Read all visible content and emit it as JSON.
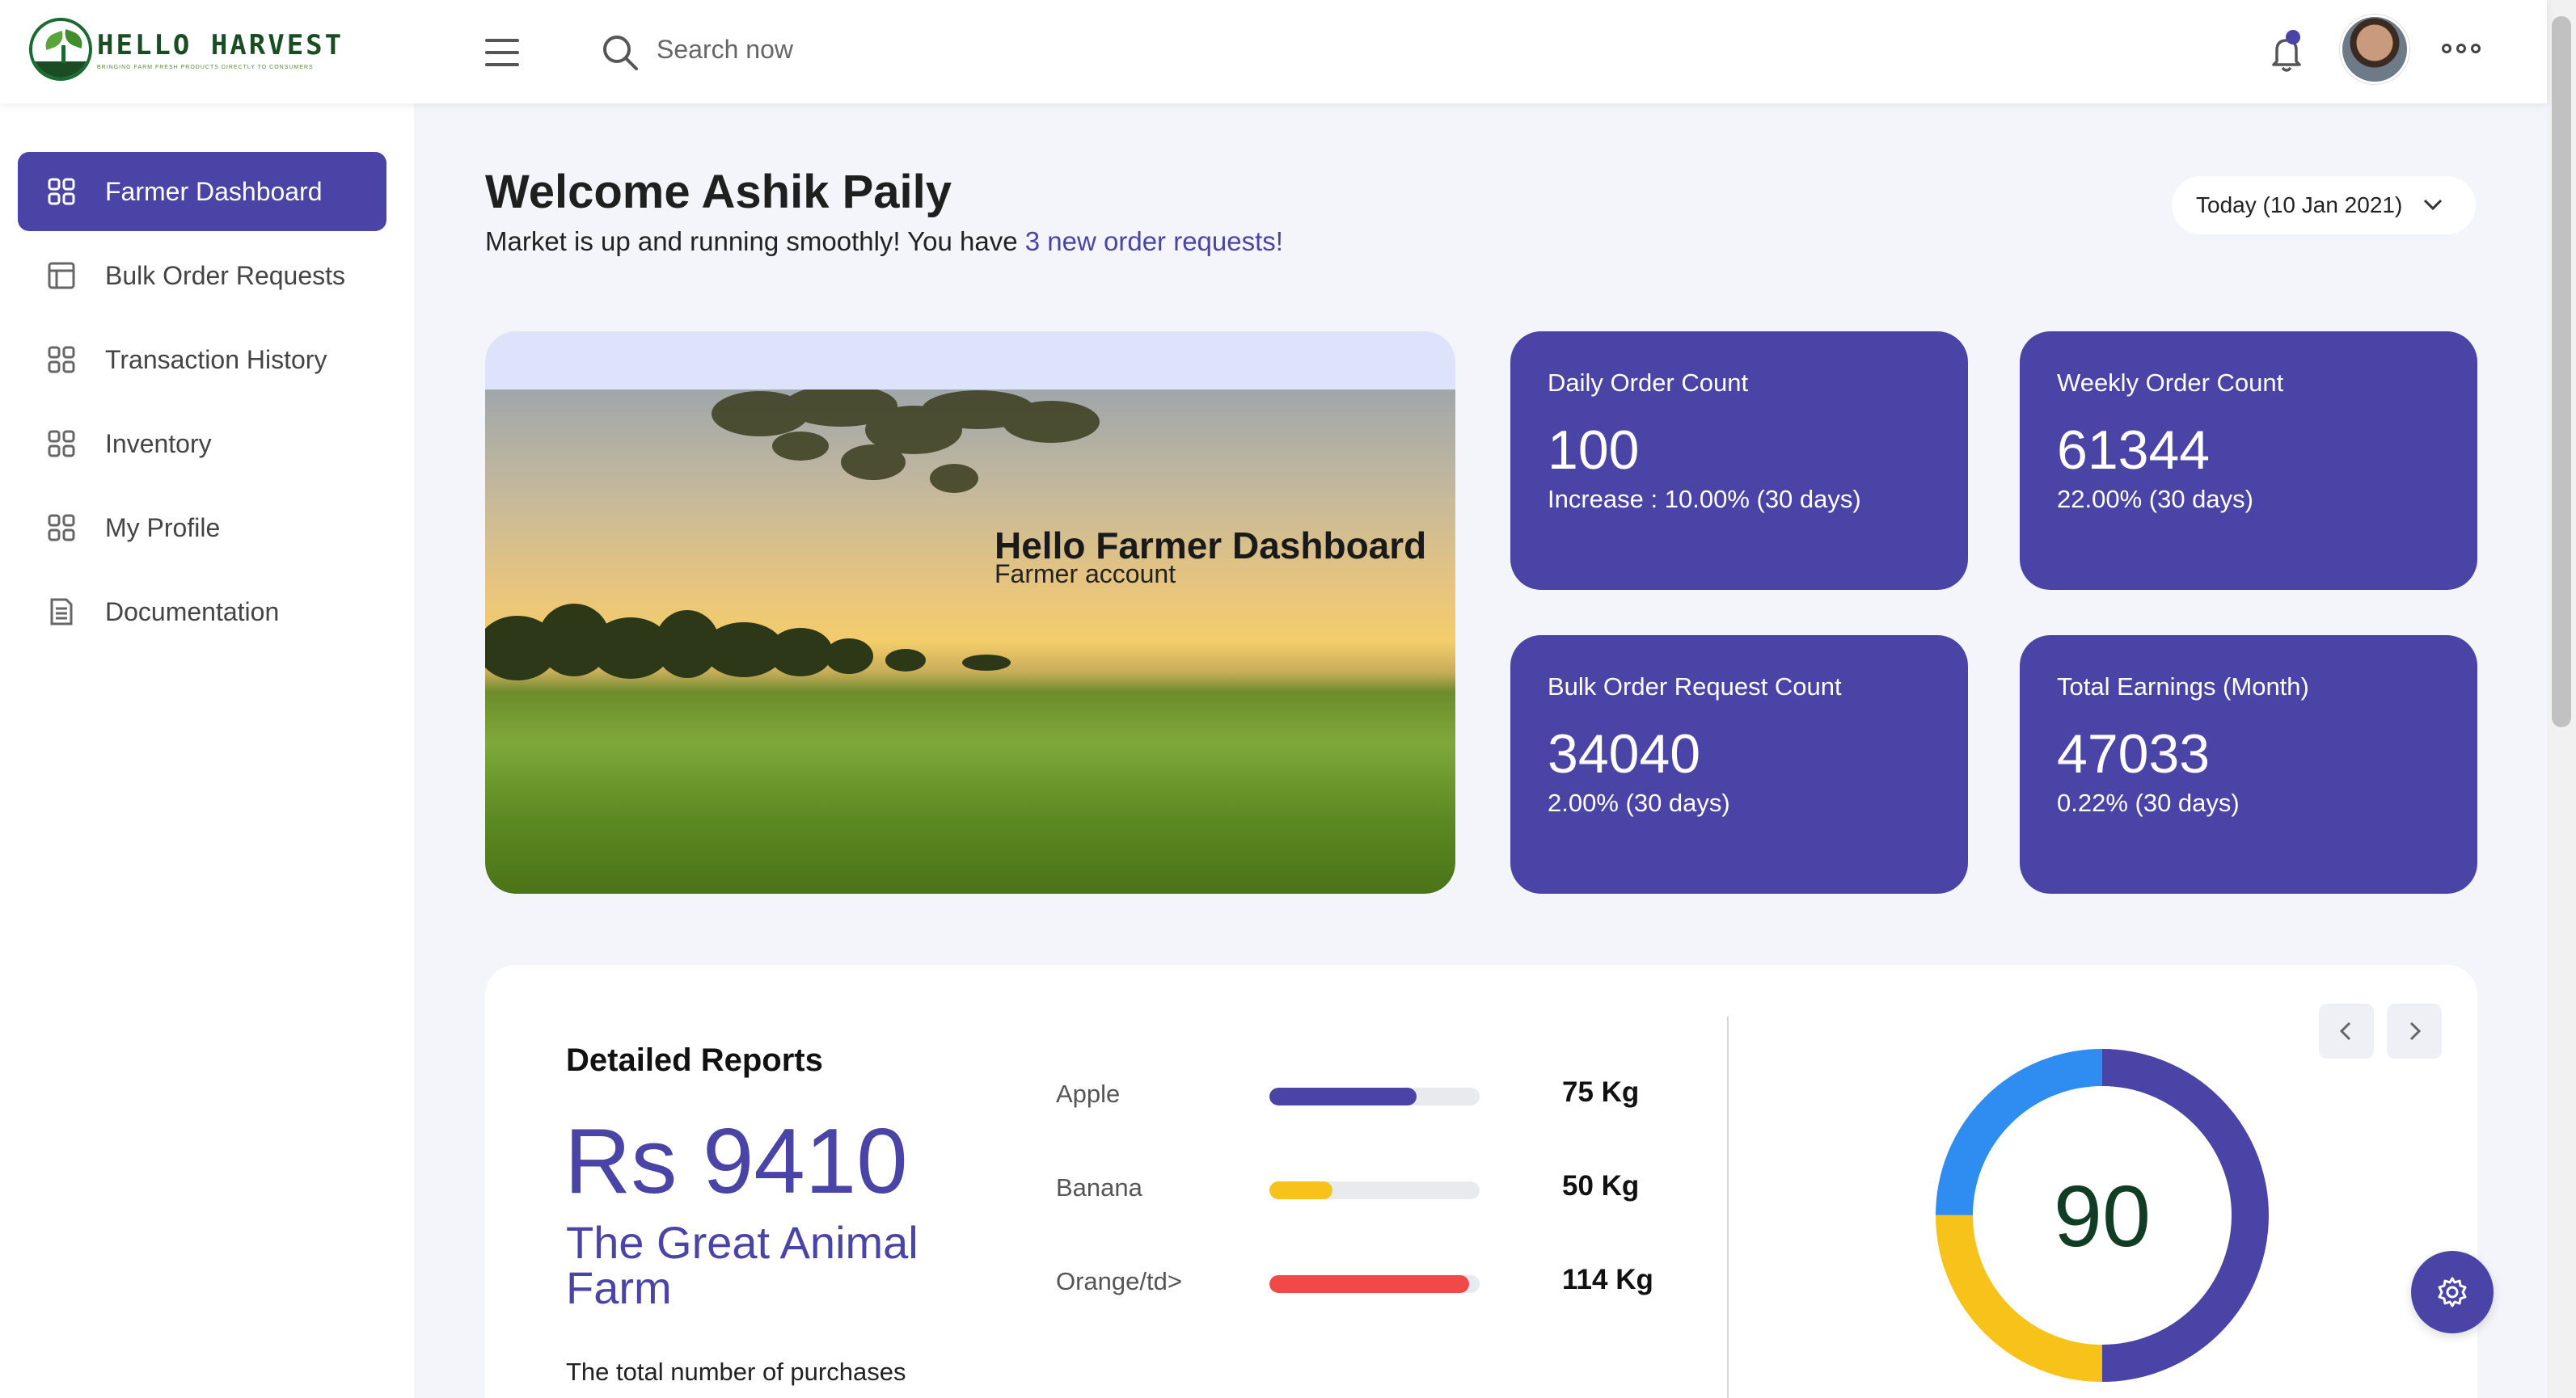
{
  "brand": {
    "name": "HELLO HARVEST",
    "tagline": "BRINGING FARM FRESH PRODUCTS DIRECTLY TO CONSUMERS"
  },
  "header": {
    "search_placeholder": "Search now",
    "notification_indicator": true
  },
  "sidebar": {
    "items": [
      {
        "label": "Farmer Dashboard",
        "icon": "grid-icon",
        "active": true
      },
      {
        "label": "Bulk Order Requests",
        "icon": "layout-icon",
        "active": false
      },
      {
        "label": "Transaction History",
        "icon": "grid-icon",
        "active": false
      },
      {
        "label": "Inventory",
        "icon": "grid-icon",
        "active": false
      },
      {
        "label": "My Profile",
        "icon": "grid-icon",
        "active": false
      },
      {
        "label": "Documentation",
        "icon": "document-icon",
        "active": false
      }
    ]
  },
  "main": {
    "welcome": "Welcome Ashik Paily",
    "subtitle_prefix": "Market is up and running smoothly! You have ",
    "subtitle_link": "3 new order requests!",
    "date_filter": "Today (10 Jan 2021)"
  },
  "hero": {
    "title": "Hello Farmer Dashboard",
    "subtitle": "Farmer account"
  },
  "stats": [
    {
      "title": "Daily Order Count",
      "value": "100",
      "change": "Increase : 10.00% (30 days)"
    },
    {
      "title": "Weekly Order Count",
      "value": "61344",
      "change": "22.00% (30 days)"
    },
    {
      "title": "Bulk Order Request Count",
      "value": "34040",
      "change": "2.00% (30 days)"
    },
    {
      "title": "Total Earnings (Month)",
      "value": "47033",
      "change": "0.22% (30 days)"
    }
  ],
  "report": {
    "title": "Detailed Reports",
    "amount": "Rs 9410",
    "farm": "The Great Animal Farm",
    "description": "The total number of purchases",
    "items": [
      {
        "name": "Apple",
        "quantity": "75 Kg",
        "progress": 0.7,
        "color": "#4a44a6"
      },
      {
        "name": "Banana",
        "quantity": "50 Kg",
        "progress": 0.3,
        "color": "#f7c21a"
      },
      {
        "name": "Orange/td>",
        "quantity": "114 Kg",
        "progress": 0.95,
        "color": "#f24848"
      }
    ],
    "donut": {
      "value": "90",
      "segments": [
        {
          "share": 0.5,
          "color": "#4a44a6"
        },
        {
          "share": 0.25,
          "color": "#f7c21a"
        },
        {
          "share": 0.25,
          "color": "#2f8cf0"
        }
      ]
    }
  },
  "colors": {
    "primary": "#4a44a6",
    "background": "#f3f5fb",
    "brand_green": "#1a4d24"
  }
}
